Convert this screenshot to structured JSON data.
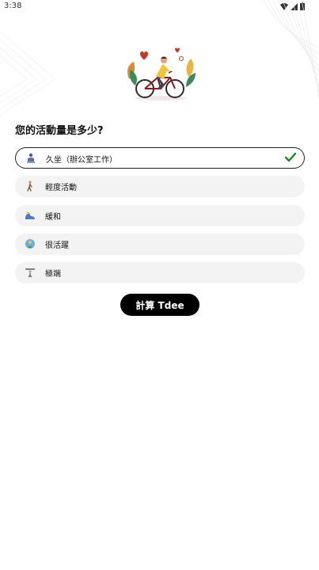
{
  "status_bar": {
    "time": "3:38"
  },
  "question": "您的活動量是多少?",
  "options": [
    {
      "label": "久坐（辦公室工作）",
      "icon": "sitting-person-icon",
      "selected": true
    },
    {
      "label": "輕度活動",
      "icon": "walking-person-icon",
      "selected": false
    },
    {
      "label": "緩和",
      "icon": "running-shoe-icon",
      "selected": false
    },
    {
      "label": "很活躍",
      "icon": "active-person-icon",
      "selected": false
    },
    {
      "label": "極端",
      "icon": "weightlifting-icon",
      "selected": false
    }
  ],
  "calculate_button": "計算 Tdee",
  "colors": {
    "accent": "#000000",
    "check": "#1a8a1a",
    "option_bg": "#f3f3f3"
  }
}
